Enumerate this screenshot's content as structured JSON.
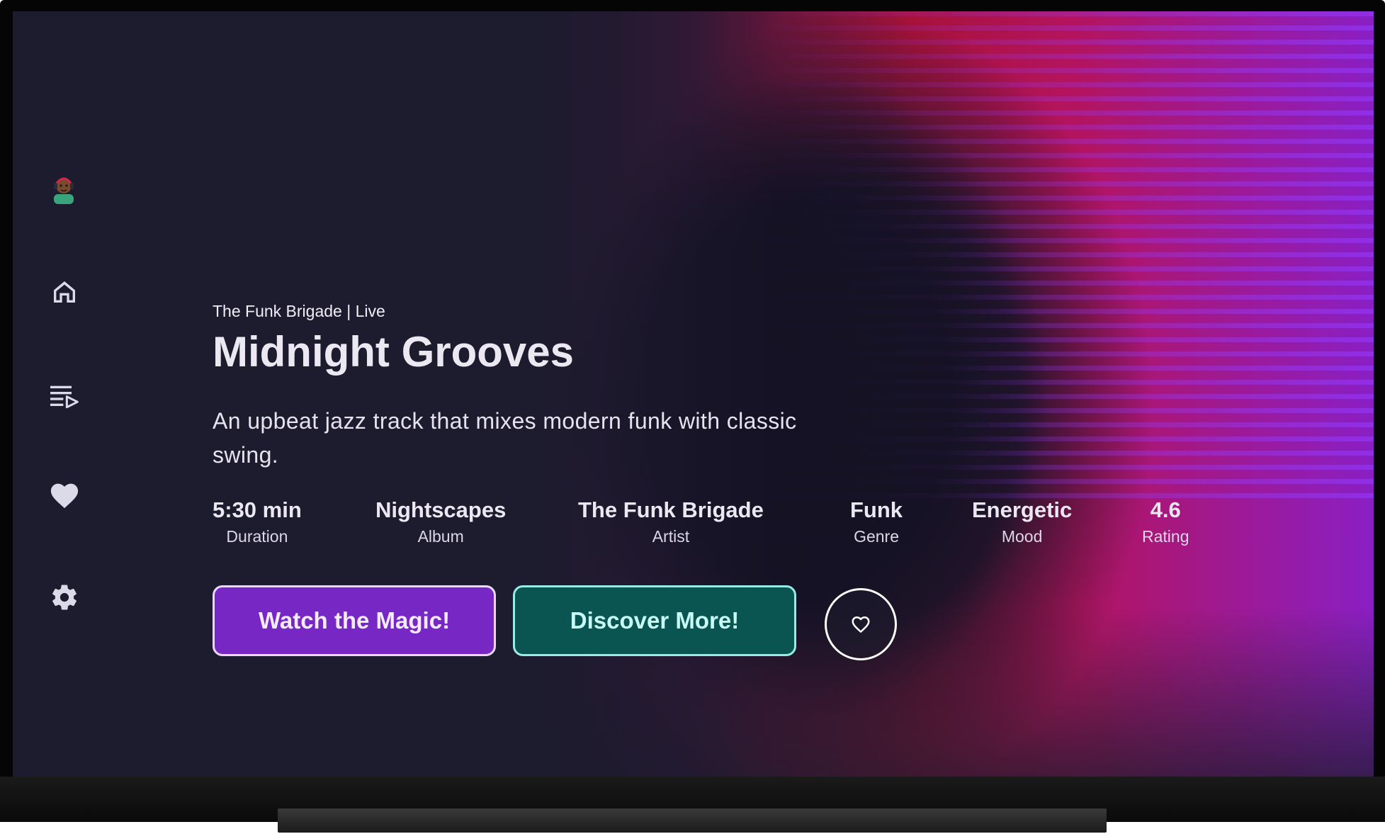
{
  "nav": {
    "avatar": "user-avatar",
    "items": [
      {
        "icon": "home-icon"
      },
      {
        "icon": "playlist-icon"
      },
      {
        "icon": "heart-icon"
      },
      {
        "icon": "settings-icon"
      }
    ]
  },
  "hero": {
    "subtitle": "The Funk Brigade | Live",
    "title": "Midnight Grooves",
    "description": "An upbeat jazz track that mixes modern funk with classic swing."
  },
  "stats": [
    {
      "value": "5:30 min",
      "label": "Duration"
    },
    {
      "value": "Nightscapes",
      "label": "Album"
    },
    {
      "value": "The Funk Brigade",
      "label": "Artist"
    },
    {
      "value": "Funk",
      "label": "Genre"
    },
    {
      "value": "Energetic",
      "label": "Mood"
    },
    {
      "value": "4.6",
      "label": "Rating"
    }
  ],
  "actions": {
    "primary_label": "Watch the Magic!",
    "secondary_label": "Discover More!",
    "favorite_icon": "heart-outline-icon"
  },
  "colors": {
    "background": "#1d1b2e",
    "primary_button": "#7627c4",
    "secondary_button": "#0a5552",
    "secondary_border": "#97ece7"
  }
}
